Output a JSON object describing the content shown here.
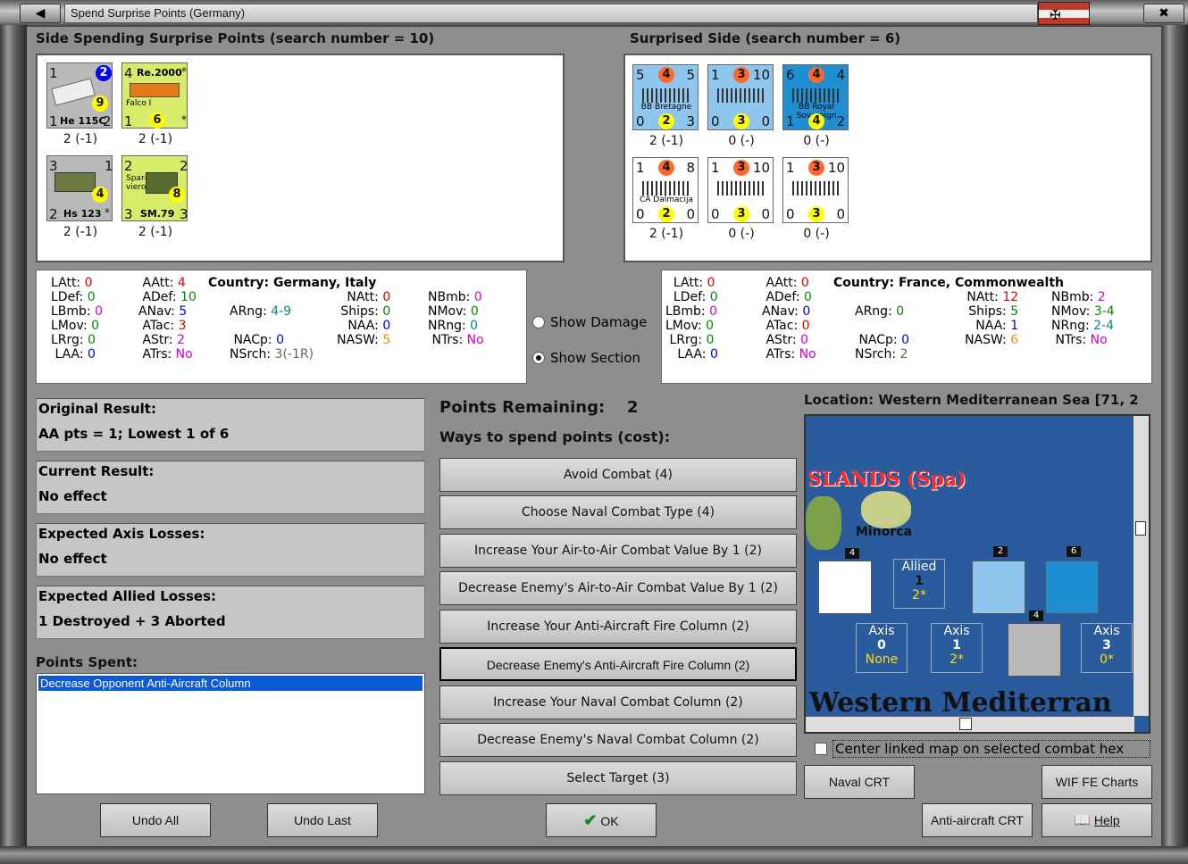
{
  "window": {
    "title": "Spend Surprise Points (Germany)"
  },
  "left_side": {
    "heading": "Side Spending Surprise Points (search number = 10)",
    "units": [
      {
        "name": "He 115C",
        "tl": "1",
        "tr": "2",
        "mid": "9",
        "bl": "1",
        "br": "2",
        "label": "2 (-1)"
      },
      {
        "name": "Re.2000",
        "sub": "Falco I",
        "tl": "4",
        "tr": "*",
        "mid": "6",
        "bl": "1",
        "br": "*",
        "label": "2 (-1)"
      },
      {
        "name": "Hs 123",
        "tl": "3",
        "tr": "1",
        "mid": "4",
        "bl": "2",
        "br": "*",
        "label": "2 (-1)"
      },
      {
        "name": "SM.79",
        "sub": "Spar-viero",
        "tl": "2",
        "tr": "2",
        "mid": "8",
        "bl": "3",
        "br": "3",
        "label": "2 (-1)"
      }
    ],
    "stats": {
      "LAtt": "0",
      "LDef": "0",
      "LBmb": "0",
      "LMov": "0",
      "LRrg": "0",
      "LAA": "0",
      "AAtt": "4",
      "ADef": "10",
      "ANav": "5",
      "ATac": "3",
      "AStr": "2",
      "ATrs": "No",
      "country": "Country: Germany, Italy",
      "ARng": "4-9",
      "NACp": "0",
      "NSrch": "3(-1R)",
      "NAtt": "0",
      "Ships": "0",
      "NAA": "0",
      "NASW": "5",
      "NBmb": "0",
      "NMov": "0",
      "NRng": "0",
      "NTrs": "No"
    }
  },
  "right_side": {
    "heading": "Surprised Side (search number = 6)",
    "units": [
      {
        "name": "BB Bretagne",
        "tl": "5",
        "tc": "4",
        "tr": "5",
        "bl": "0",
        "bc": "2",
        "br": "3",
        "label": "2 (-1)"
      },
      {
        "name": "",
        "tl": "1",
        "tc": "3",
        "tr": "10",
        "bl": "0",
        "bc": "3",
        "br": "0",
        "label": "0 (-)"
      },
      {
        "name": "BB Royal Sovereign",
        "tl": "6",
        "tc": "4",
        "tr": "4",
        "bl": "1",
        "bc": "4",
        "br": "2",
        "label": "0 (-)"
      },
      {
        "name": "CA Dalmacija",
        "tl": "1",
        "tc": "4",
        "tr": "8",
        "bl": "0",
        "bc": "2",
        "br": "0",
        "label": "2 (-1)"
      },
      {
        "name": "",
        "tl": "1",
        "tc": "3",
        "tr": "10",
        "bl": "0",
        "bc": "3",
        "br": "0",
        "label": "0 (-)"
      },
      {
        "name": "",
        "tl": "1",
        "tc": "3",
        "tr": "10",
        "bl": "0",
        "bc": "3",
        "br": "0",
        "label": "0 (-)"
      }
    ],
    "stats": {
      "LAtt": "0",
      "LDef": "0",
      "LBmb": "0",
      "LMov": "0",
      "LRrg": "0",
      "LAA": "0",
      "AAtt": "0",
      "ADef": "0",
      "ANav": "0",
      "ATac": "0",
      "AStr": "0",
      "ATrs": "No",
      "country": "Country: France, Commonwealth",
      "ARng": "0",
      "NACp": "0",
      "NSrch": "2",
      "NAtt": "12",
      "Ships": "5",
      "NAA": "1",
      "NASW": "6",
      "NBmb": "2",
      "NMov": "3-4",
      "NRng": "2-4",
      "NTrs": "No"
    }
  },
  "toggles": {
    "show_damage": "Show Damage",
    "show_section": "Show Section"
  },
  "results": {
    "original_title": "Original Result:",
    "original_value": "AA pts = 1; Lowest 1 of 6",
    "current_title": "Current Result:",
    "current_value": "No effect",
    "axis_title": "Expected Axis Losses:",
    "axis_value": "No effect",
    "allied_title": "Expected Allied Losses:",
    "allied_value": "1 Destroyed + 3 Aborted"
  },
  "points_spent": {
    "title": "Points Spent:",
    "items": [
      "Decrease Opponent Anti-Aircraft Column"
    ]
  },
  "points": {
    "remaining_label": "Points Remaining:",
    "remaining_value": "2",
    "ways_label": "Ways to spend points (cost):"
  },
  "options": [
    "Avoid Combat (4)",
    "Choose Naval Combat Type (4)",
    "Increase Your Air-to-Air Combat Value By 1 (2)",
    "Decrease Enemy's Air-to-Air Combat Value By 1 (2)",
    "Increase Your Anti-Aircraft Fire Column (2)",
    "Decrease Enemy's Anti-Aircraft Fire Column (2)",
    "Increase Your Naval Combat Column (2)",
    "Decrease Enemy's Naval Combat Column (2)",
    "Select Target (3)"
  ],
  "map": {
    "location": "Location: Western Mediterranean Sea [71, 2",
    "region": "SLANDS (Spa)",
    "island": "Minorca",
    "sea": "Western Mediterran",
    "boxes": {
      "allied": {
        "t": "Allied",
        "n": "1",
        "v": "2*"
      },
      "axis0": {
        "t": "Axis",
        "n": "0",
        "v": "None"
      },
      "axis1": {
        "t": "Axis",
        "n": "1",
        "v": "2*"
      },
      "axis3": {
        "t": "Axis",
        "n": "3",
        "v": "0*"
      }
    },
    "stack_counts": {
      "a": "4",
      "b": "2",
      "c": "6",
      "d": "4"
    },
    "center_link": "Center linked map on selected combat hex"
  },
  "buttons": {
    "undo_all": "Undo All",
    "undo_last": "Undo Last",
    "ok": "OK",
    "naval_crt": "Naval CRT",
    "wif_fe": "WIF FE Charts",
    "aa_crt": "Anti-aircraft CRT",
    "help": "Help"
  },
  "colors": {
    "selection": "#0a5ad6",
    "map_sea": "#2a5b9c",
    "counter_yellow": "#d8ec6a",
    "counter_grey": "#b9b9b9",
    "counter_blue": "#8ec6ee"
  }
}
